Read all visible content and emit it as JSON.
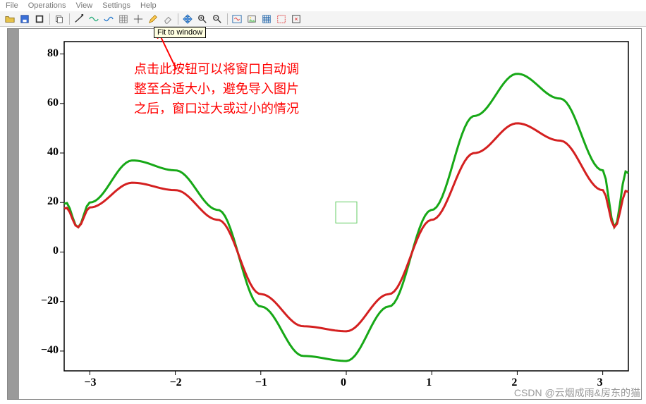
{
  "menu": {
    "items": [
      "File",
      "Operations",
      "View",
      "Settings",
      "Help"
    ]
  },
  "toolbar": {
    "buttons": [
      "open-icon",
      "save-icon",
      "export-icon",
      "copy-icon",
      "line-tool-icon",
      "wave1-icon",
      "wave2-icon",
      "grid-tool-icon",
      "crosshair-icon",
      "pencil-icon",
      "eraser-icon",
      "hand-pan-icon",
      "zoom-in-icon",
      "zoom-out-icon",
      "fit-window-icon",
      "image-icon",
      "grid-toggle-icon",
      "box-select-icon",
      "resize-icon"
    ],
    "tooltip": "Fit to window"
  },
  "annotation": {
    "line1": "点击此按钮可以将窗口自动调",
    "line2": "整至合适大小，避免导入图片",
    "line3": "之后，窗口过大或过小的情况"
  },
  "watermark": "CSDN @云烟成雨&房东的猫",
  "chart_data": {
    "type": "line",
    "x": [
      -3.14,
      -3,
      -2.5,
      -2,
      -1.5,
      -1,
      -0.5,
      0,
      0.5,
      1,
      1.5,
      2,
      2.5,
      3,
      3.14
    ],
    "series": [
      {
        "name": "green",
        "color": "#17a817",
        "values": [
          10,
          20,
          37,
          33,
          17,
          -22,
          -42,
          -44,
          -22,
          17,
          55,
          72,
          62,
          33,
          10
        ]
      },
      {
        "name": "red",
        "color": "#d42020",
        "values": [
          10,
          18,
          28,
          25,
          13,
          -17,
          -30,
          -32,
          -17,
          13,
          40,
          52,
          45,
          25,
          10
        ]
      }
    ],
    "x_ticks": [
      -3,
      -2,
      -1,
      0,
      1,
      2,
      3
    ],
    "y_ticks": [
      -40,
      -20,
      0,
      20,
      40,
      60,
      80
    ],
    "xlim": [
      -3.3,
      3.3
    ],
    "ylim": [
      -48,
      85
    ],
    "marker_box": {
      "x": 0,
      "y": 16,
      "size": 30
    }
  },
  "colors": {
    "annotation": "#ff0000",
    "green": "#17a817",
    "red": "#d42020"
  }
}
